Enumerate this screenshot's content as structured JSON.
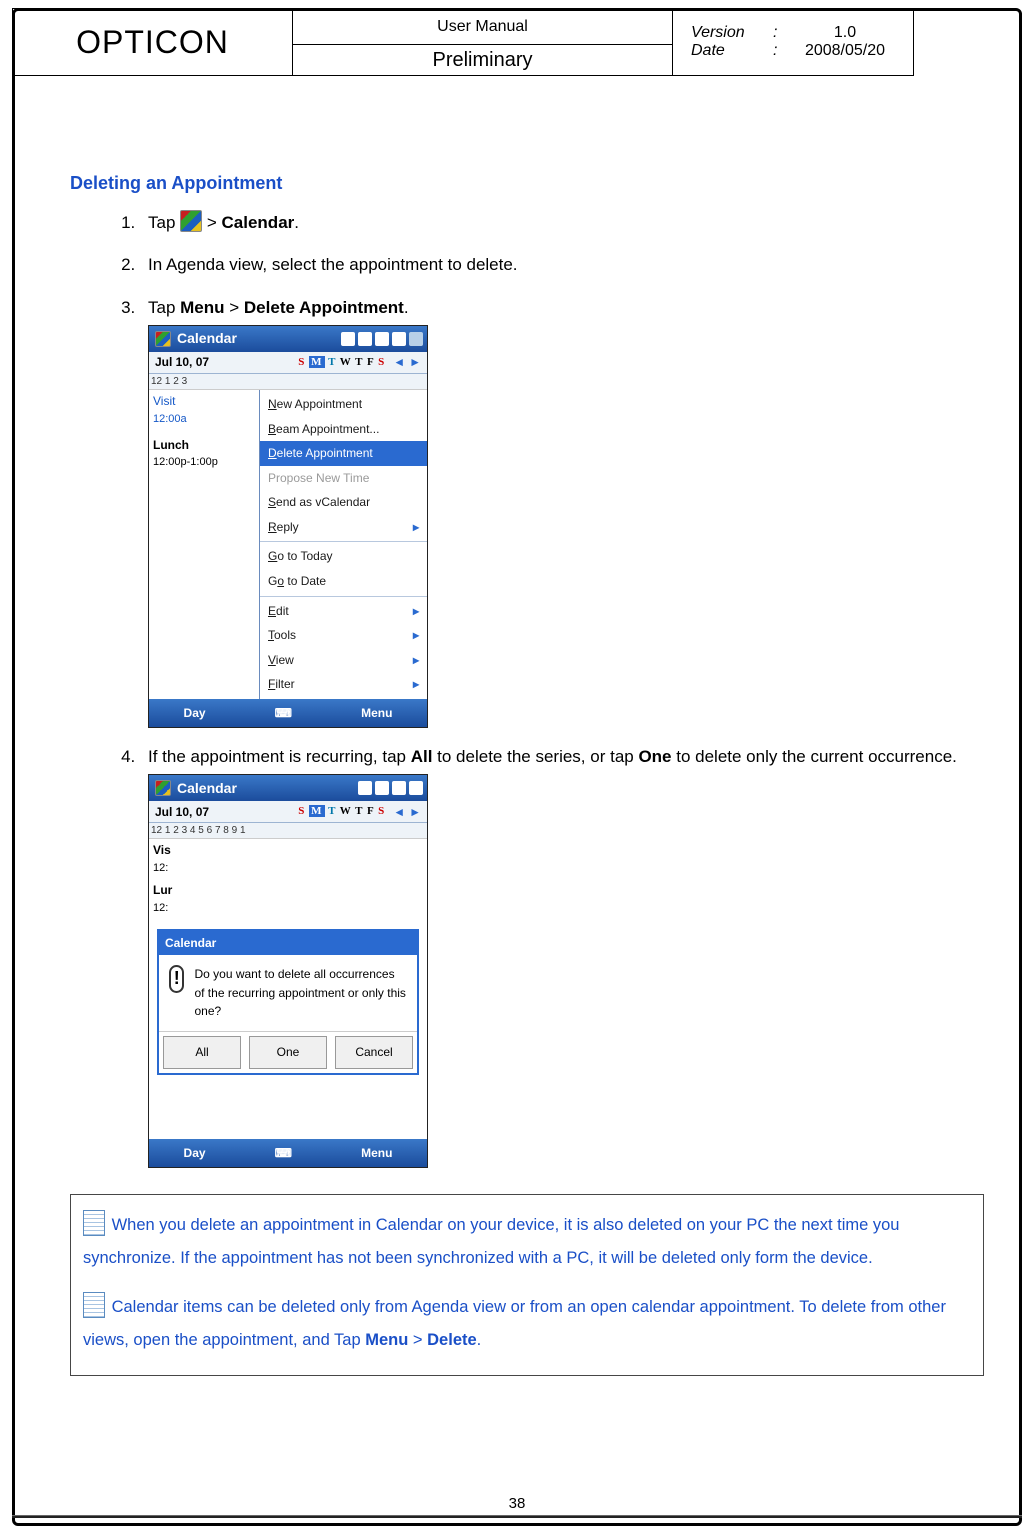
{
  "header": {
    "brand": "OPTICON",
    "title": "User Manual",
    "subtitle": "Preliminary",
    "meta": {
      "version_label": "Version",
      "version_value": "1.0",
      "date_label": "Date",
      "date_value": "2008/05/20",
      "colon": ":"
    }
  },
  "page_number": "38",
  "section_title": "Deleting an Appointment",
  "steps": {
    "s1_pre": "Tap ",
    "s1_post": " > ",
    "s1_bold": "Calendar",
    "s1_period": ".",
    "s2": "In Agenda view, select the appointment to delete.",
    "s3_pre": "Tap ",
    "s3_b1": "Menu",
    "s3_mid": " > ",
    "s3_b2": "Delete Appointment",
    "s3_period": ".",
    "s4_pre": "If the appointment is recurring, tap ",
    "s4_b1": "All",
    "s4_mid1": " to delete the series, or tap ",
    "s4_b2": "One",
    "s4_mid2": " to delete only the current occurrence."
  },
  "screenshot1": {
    "app_title": "Calendar",
    "date_left": "Jul  10, 07",
    "days_s": "S",
    "days_m": "M",
    "days_t": "T",
    "days_w": "W",
    "days_t2": "T",
    "days_f": "F",
    "days_s2": "S",
    "ruler": "12    1    2    3",
    "appt1_title": "Visit",
    "appt1_time": "12:00a",
    "appt2_title": "Lunch",
    "appt2_time": "12:00p-1:00p",
    "menu": {
      "new": "New Appointment",
      "beam": "Beam Appointment...",
      "del": "Delete Appointment",
      "propose": "Propose New Time",
      "send": "Send as vCalendar",
      "reply": "Reply",
      "goto_today": "Go to Today",
      "goto_date": "Go to Date",
      "edit": "Edit",
      "tools": "Tools",
      "view": "View",
      "filter": "Filter"
    },
    "soft_left": "Day",
    "soft_right": "Menu"
  },
  "screenshot2": {
    "app_title": "Calendar",
    "date_left": "Jul  10, 07",
    "ruler": "12   1   2   3   4   5   6   7   8   9   1",
    "left1": "Vis",
    "left1b": "12:",
    "left2": "Lur",
    "left2b": "12:",
    "dlg_title": "Calendar",
    "dlg_text": "Do you want to delete all occurrences of the recurring appointment or only this one?",
    "btn_all": "All",
    "btn_one": "One",
    "btn_cancel": "Cancel",
    "soft_left": "Day",
    "soft_right": "Menu"
  },
  "notes": {
    "n1": "When you delete an appointment in Calendar on your device, it is also deleted on your PC the next time you synchronize. If the appointment has not been synchronized with a PC, it will be deleted only form the device.",
    "n2_pre": "Calendar items can be deleted only from Agenda view or from an open calendar appointment. To delete from other views, open the appointment, and Tap ",
    "n2_b1": "Menu",
    "n2_mid": " > ",
    "n2_b2": "Delete",
    "n2_period": "."
  }
}
